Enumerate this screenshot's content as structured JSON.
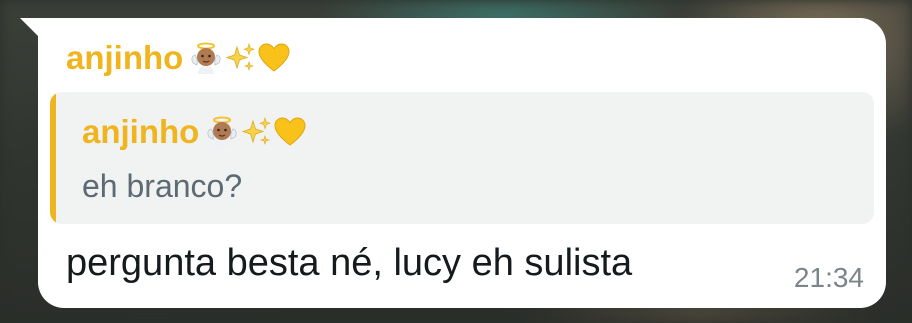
{
  "chat": {
    "message": {
      "sender_name": "anjinho",
      "sender_emojis": [
        "baby-angel-emoji",
        "sparkles-emoji",
        "yellow-heart-emoji"
      ],
      "sender_color": "#f0b41f",
      "quoted": {
        "sender_name": "anjinho",
        "text": "eh branco?"
      },
      "text": "pergunta besta né, lucy eh sulista",
      "time": "21:34"
    }
  }
}
